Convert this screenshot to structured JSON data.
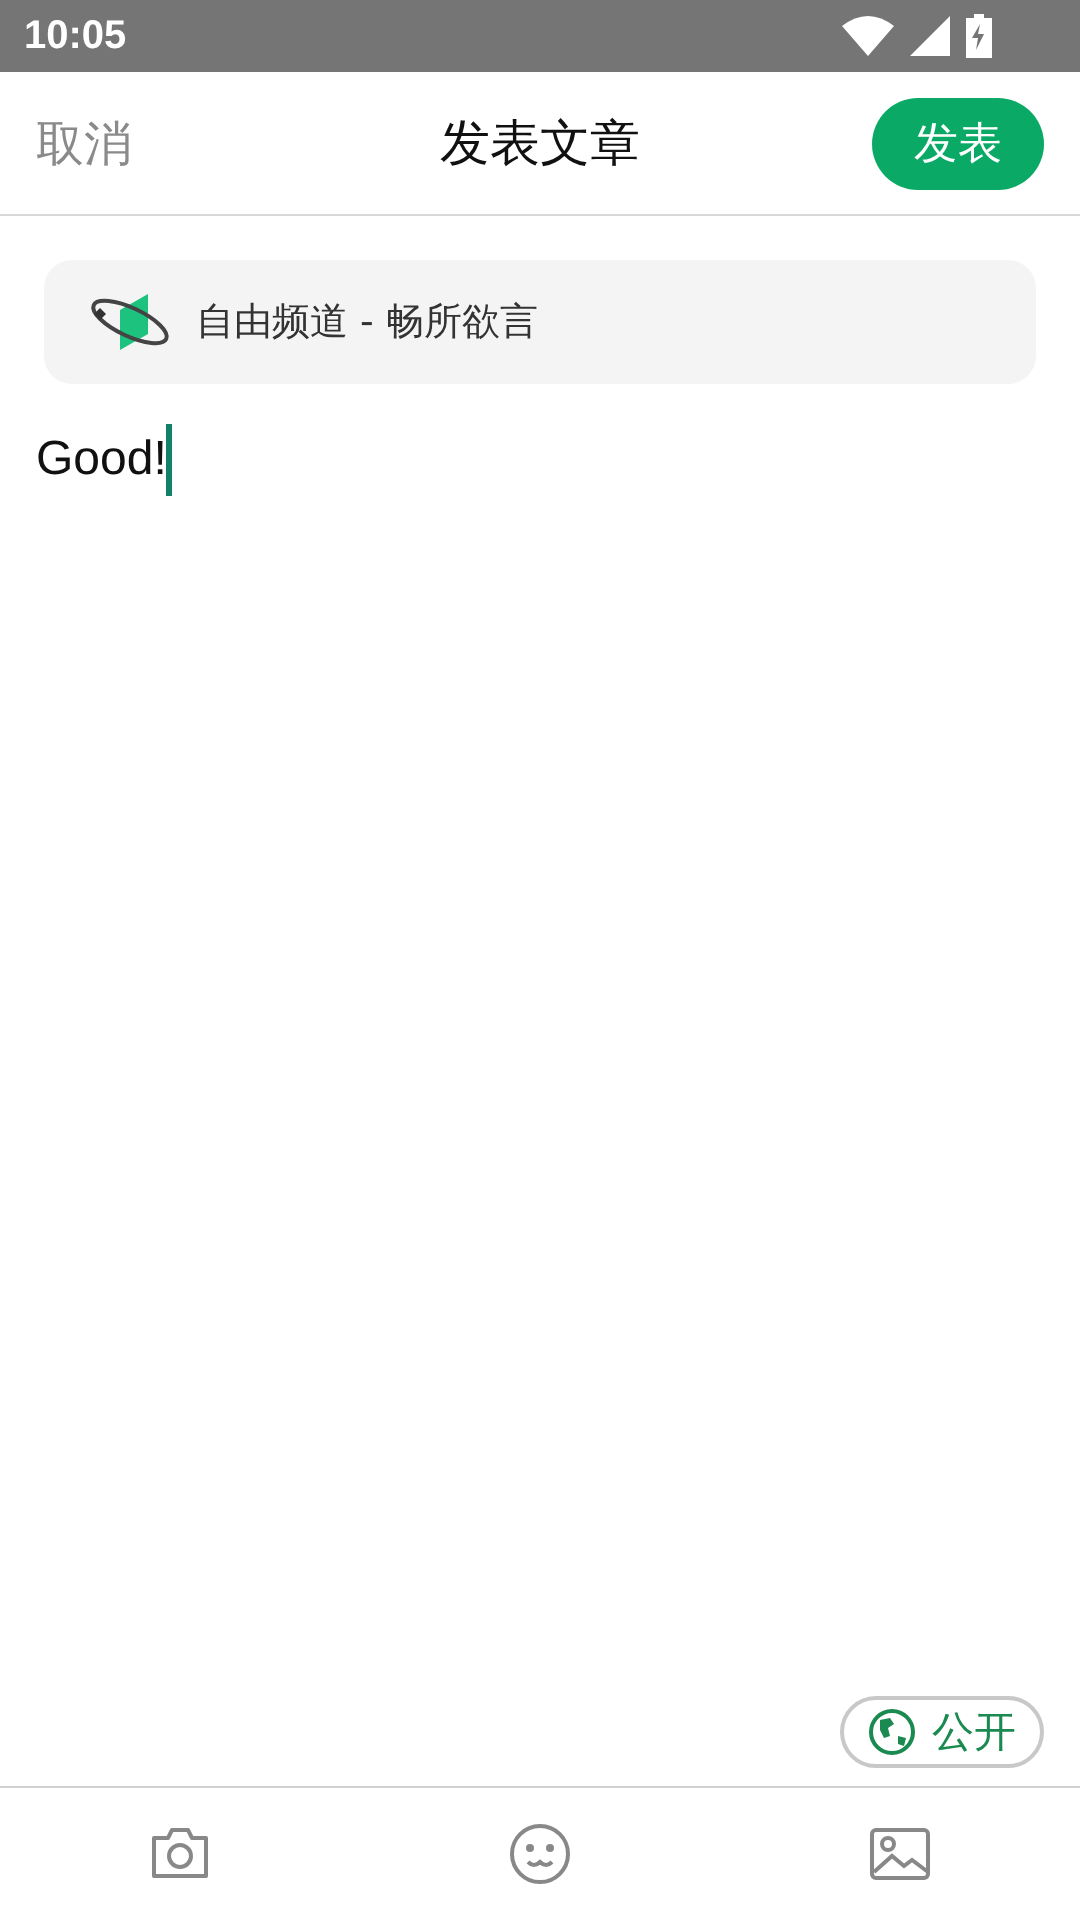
{
  "status_bar": {
    "time": "10:05"
  },
  "header": {
    "cancel": "取消",
    "title": "发表文章",
    "publish": "发表"
  },
  "channel": {
    "label": "自由频道 - 畅所欲言"
  },
  "editor": {
    "value": "Good!"
  },
  "visibility": {
    "label": "公开"
  }
}
